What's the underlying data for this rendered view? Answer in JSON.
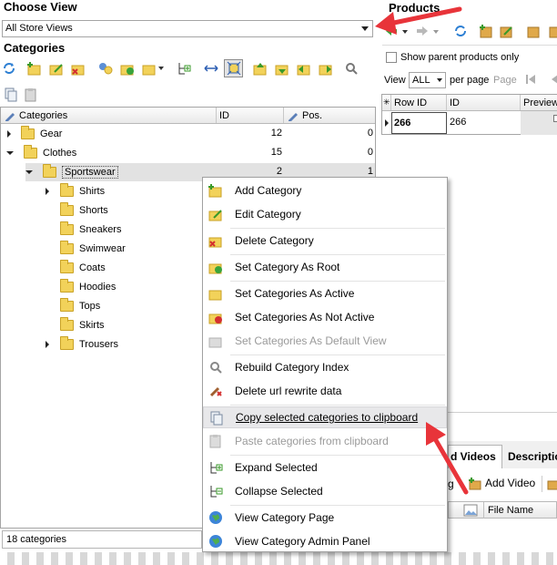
{
  "choose_view": {
    "title": "Choose View",
    "store_select": "All Store Views"
  },
  "categories_panel": {
    "title": "Categories",
    "columns": [
      "Categories",
      "ID",
      "Pos."
    ],
    "rows": [
      {
        "name": "Gear",
        "id": "12",
        "pos": "0"
      },
      {
        "name": "Clothes",
        "id": "15",
        "pos": "0"
      },
      {
        "name": "Sportswear",
        "id": "2",
        "pos": "1"
      },
      {
        "name": "Shirts"
      },
      {
        "name": "Shorts"
      },
      {
        "name": "Sneakers"
      },
      {
        "name": "Swimwear"
      },
      {
        "name": "Coats"
      },
      {
        "name": "Hoodies"
      },
      {
        "name": "Tops"
      },
      {
        "name": "Skirts"
      },
      {
        "name": "Trousers"
      }
    ],
    "status": "18 categories"
  },
  "products_panel": {
    "title": "Products",
    "show_parent": "Show parent products only",
    "view_label": "View",
    "view_value": "ALL",
    "per_page": "per page",
    "page_label": "Page",
    "grid_headers": [
      "Row ID",
      "ID",
      "Preview"
    ],
    "grid_row": {
      "row_id": "266",
      "id": "266"
    },
    "tabs": [
      "d Videos",
      "Descriptio"
    ],
    "add_video": "Add Video",
    "partial_label": "g",
    "file_name_col": "File Name"
  },
  "context_menu": {
    "items": [
      {
        "label": "Add Category",
        "icon": "add-category-icon",
        "disabled": false
      },
      {
        "label": "Edit Category",
        "icon": "edit-category-icon",
        "disabled": false
      },
      {
        "label": "Delete Category",
        "icon": "delete-category-icon",
        "disabled": false
      },
      {
        "label": "Set Category As Root",
        "icon": "set-root-icon",
        "disabled": false
      },
      {
        "label": "Set Categories As Active",
        "icon": "set-active-icon",
        "disabled": false
      },
      {
        "label": "Set Categories As Not Active",
        "icon": "set-not-active-icon",
        "disabled": false
      },
      {
        "label": "Set Categories As Default View",
        "icon": "set-default-view-icon",
        "disabled": true
      },
      {
        "label": "Rebuild Category Index",
        "icon": "rebuild-index-icon",
        "disabled": false
      },
      {
        "label": "Delete url rewrite data",
        "icon": "delete-url-rewrite-icon",
        "disabled": false
      },
      {
        "label": "Copy selected categories to clipboard",
        "icon": "copy-icon",
        "disabled": false
      },
      {
        "label": "Paste categories from clipboard",
        "icon": "paste-icon",
        "disabled": true
      },
      {
        "label": "Expand Selected",
        "icon": "expand-icon",
        "disabled": false
      },
      {
        "label": "Collapse Selected",
        "icon": "collapse-icon",
        "disabled": false
      },
      {
        "label": "View Category Page",
        "icon": "globe-icon",
        "disabled": false
      },
      {
        "label": "View Category Admin Panel",
        "icon": "globe-icon",
        "disabled": false
      }
    ]
  },
  "colors": {
    "accent_red": "#e8343a",
    "folder_yellow": "#f2d25a",
    "menu_highlight": "#e8e8ea"
  }
}
